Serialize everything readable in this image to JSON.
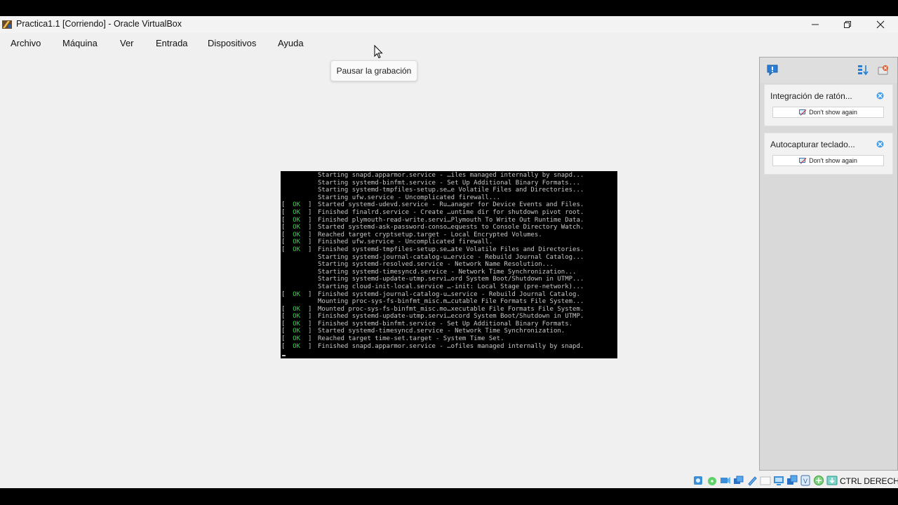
{
  "window": {
    "title": "Practica1.1 [Corriendo] - Oracle VirtualBox",
    "app_icon": "virtualbox-icon"
  },
  "menu": {
    "items": [
      "Archivo",
      "Máquina",
      "Ver",
      "Entrada",
      "Dispositivos",
      "Ayuda"
    ]
  },
  "tooltip": {
    "text": "Pausar la grabación"
  },
  "console": {
    "status_ok": "OK",
    "lines": [
      {
        "status": "",
        "text": "Starting snapd.apparmor.service - …iles managed internally by snapd..."
      },
      {
        "status": "",
        "text": "Starting systemd-binfmt.service - Set Up Additional Binary Formats..."
      },
      {
        "status": "",
        "text": "Starting systemd-tmpfiles-setup.se…e Volatile Files and Directories..."
      },
      {
        "status": "",
        "text": "Starting ufw.service - Uncomplicated firewall..."
      },
      {
        "status": "OK",
        "text": "Started systemd-udevd.service - Ru…anager for Device Events and Files."
      },
      {
        "status": "OK",
        "text": "Finished finalrd.service - Create …untime dir for shutdown pivot root."
      },
      {
        "status": "OK",
        "text": "Finished plymouth-read-write.servi…Plymouth To Write Out Runtime Data."
      },
      {
        "status": "OK",
        "text": "Started systemd-ask-password-conso…equests to Console Directory Watch."
      },
      {
        "status": "OK",
        "text": "Reached target cryptsetup.target - Local Encrypted Volumes."
      },
      {
        "status": "OK",
        "text": "Finished ufw.service - Uncomplicated firewall."
      },
      {
        "status": "OK",
        "text": "Finished systemd-tmpfiles-setup.se…ate Volatile Files and Directories."
      },
      {
        "status": "",
        "text": "Starting systemd-journal-catalog-u…ervice - Rebuild Journal Catalog..."
      },
      {
        "status": "",
        "text": "Starting systemd-resolved.service - Network Name Resolution..."
      },
      {
        "status": "",
        "text": "Starting systemd-timesyncd.service - Network Time Synchronization..."
      },
      {
        "status": "",
        "text": "Starting systemd-update-utmp.servi…ord System Boot/Shutdown in UTMP..."
      },
      {
        "status": "",
        "text": "Starting cloud-init-local.service …-init: Local Stage (pre-network)..."
      },
      {
        "status": "OK",
        "text": "Finished systemd-journal-catalog-u…service - Rebuild Journal Catalog."
      },
      {
        "status": "",
        "text": "Mounting proc-sys-fs-binfmt_misc.m…cutable File Formats File System..."
      },
      {
        "status": "OK",
        "text": "Mounted proc-sys-fs-binfmt_misc.mo…xecutable File Formats File System."
      },
      {
        "status": "OK",
        "text": "Finished systemd-update-utmp.servi…ecord System Boot/Shutdown in UTMP."
      },
      {
        "status": "OK",
        "text": "Finished systemd-binfmt.service - Set Up Additional Binary Formats."
      },
      {
        "status": "OK",
        "text": "Started systemd-timesyncd.service - Network Time Synchronization."
      },
      {
        "status": "OK",
        "text": "Reached target time-set.target - System Time Set."
      },
      {
        "status": "OK",
        "text": "Finished snapd.apparmor.service - …ofiles managed internally by snapd."
      }
    ]
  },
  "notifications": {
    "cards": [
      {
        "title": "Integración de ratón...",
        "action": "Don't show again"
      },
      {
        "title": "Autocapturar teclado...",
        "action": "Don't show again"
      }
    ]
  },
  "statusbar": {
    "host_key": "CTRL DERECHA",
    "icons": [
      "hard-disk-icon",
      "optical-drive-icon",
      "audio-icon",
      "network-icon",
      "usb-icon",
      "shared-folders-icon",
      "display-icon",
      "recording-icon",
      "capture-icon",
      "mouse-integration-icon",
      "keyboard-icon",
      "arrow-down-icon"
    ]
  },
  "colors": {
    "window_bg": "#f0f0f0",
    "console_bg": "#000000",
    "console_text": "#c8c8c8",
    "console_ok": "#2fd44a",
    "panel_bg": "#d9d9d9",
    "accent_blue": "#1e78c8"
  }
}
